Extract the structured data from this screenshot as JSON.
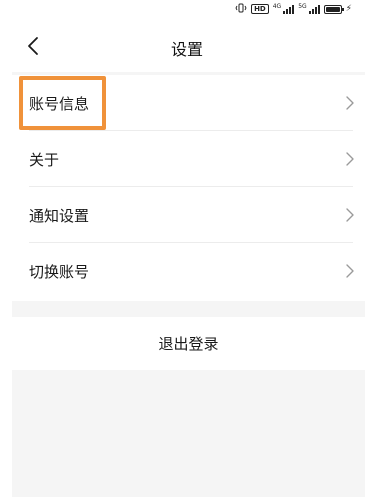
{
  "status_bar": {
    "hd_label": "HD",
    "signal1_label": "4G",
    "signal2_label": "5G",
    "charge_symbol": "⚡"
  },
  "header": {
    "back_icon": "chevron-left-icon",
    "title": "设置"
  },
  "settings": {
    "items": [
      {
        "label": "账号信息",
        "icon": "chevron-right-icon"
      },
      {
        "label": "关于",
        "icon": "chevron-right-icon"
      },
      {
        "label": "通知设置",
        "icon": "chevron-right-icon"
      },
      {
        "label": "切换账号",
        "icon": "chevron-right-icon"
      }
    ]
  },
  "logout": {
    "label": "退出登录"
  },
  "colors": {
    "highlight": "#f0923a",
    "background_gray": "#f5f5f5",
    "text": "#1a1a1a",
    "chevron": "#9a9a9a"
  }
}
